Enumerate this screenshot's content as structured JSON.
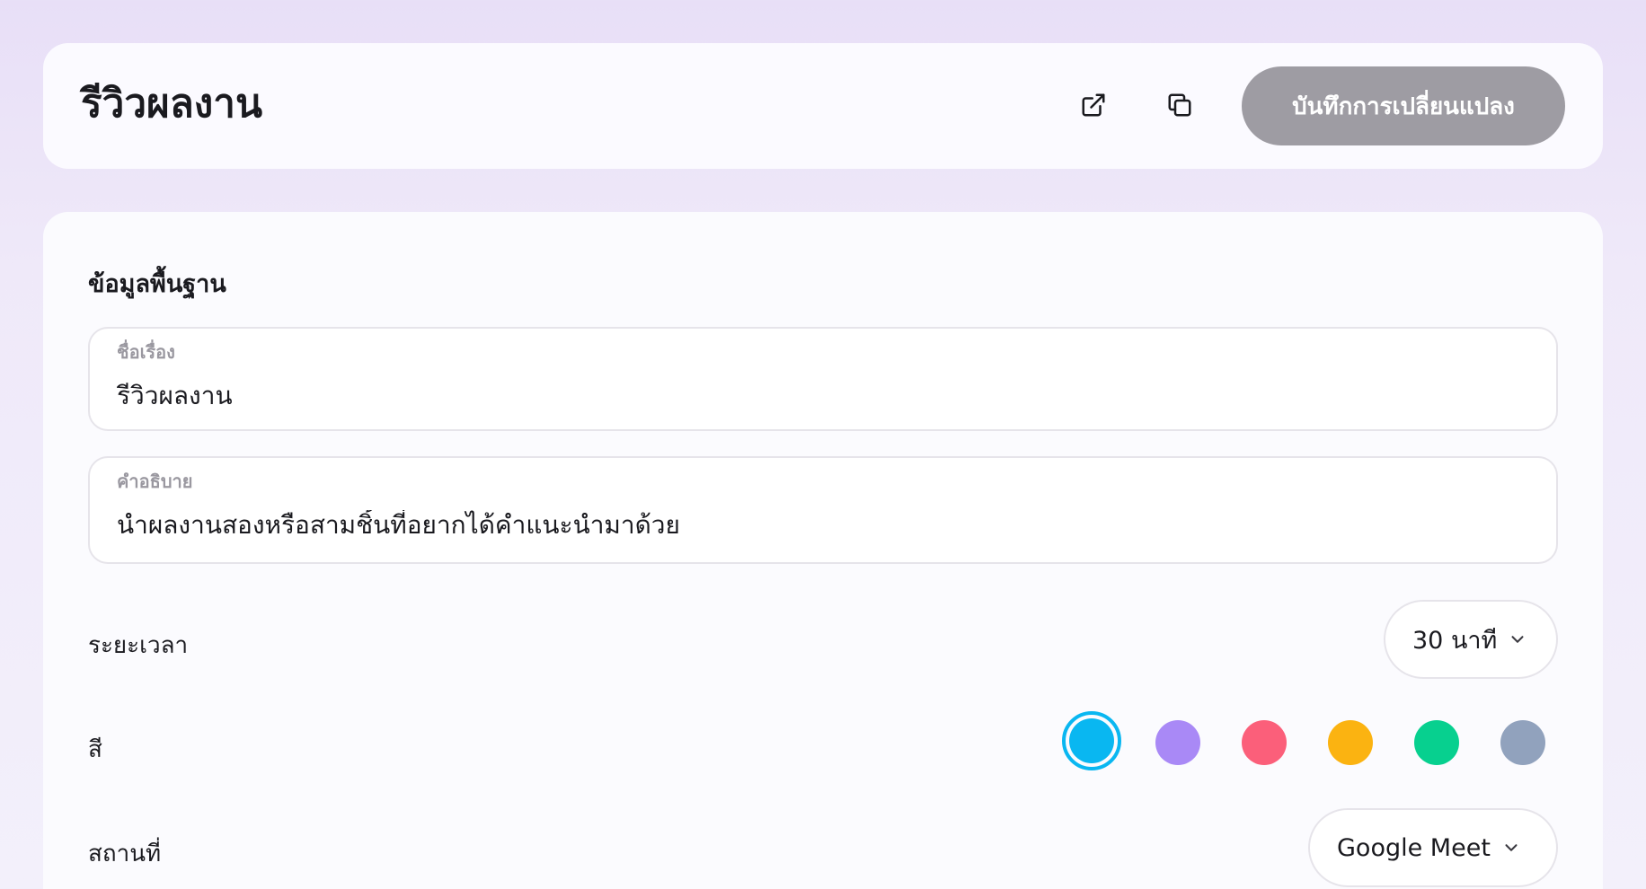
{
  "header": {
    "title": "รีวิวผลงาน",
    "open_icon": "external-link-icon",
    "copy_icon": "copy-icon",
    "save_label": "บันทึกการเปลี่ยนแปลง"
  },
  "basic_info": {
    "section_title": "ข้อมูลพื้นฐาน",
    "title_field": {
      "label": "ชื่อเรื่อง",
      "value": "รีวิวผลงาน"
    },
    "description_field": {
      "label": "คำอธิบาย",
      "value": "นำผลงานสองหรือสามชิ้นที่อยากได้คำแนะนำมาด้วย"
    },
    "duration": {
      "label": "ระยะเวลา",
      "value": "30 นาที"
    },
    "color": {
      "label": "สี",
      "options": [
        "#09b7f1",
        "#a989f6",
        "#fb5f7a",
        "#fbb311",
        "#07d08f",
        "#91a2bd"
      ],
      "selected_index": 0
    },
    "location": {
      "label": "สถานที่",
      "value": "Google Meet"
    }
  }
}
